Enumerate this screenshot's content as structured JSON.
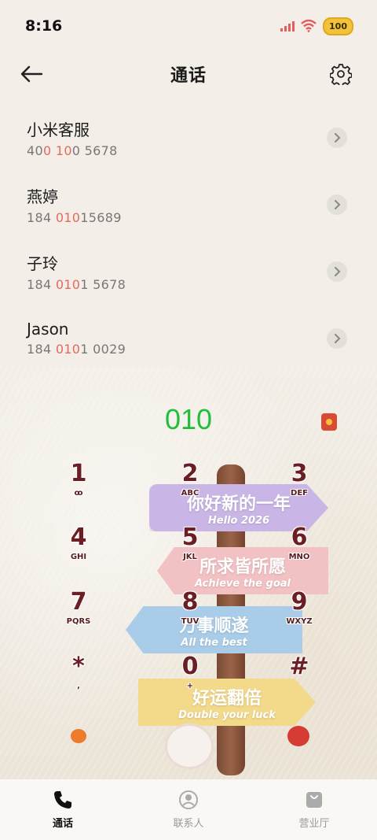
{
  "status": {
    "time": "8:16",
    "battery": "100"
  },
  "header": {
    "title": "通话"
  },
  "results": [
    {
      "name": "小米客服",
      "number_pre": "40",
      "number_hl": "0 10",
      "number_post": "0 5678"
    },
    {
      "name": "燕婷",
      "number_pre": "184 ",
      "number_hl": "010",
      "number_post": "15689"
    },
    {
      "name": "子玲",
      "number_pre": "184 ",
      "number_hl": "010",
      "number_post": "1 5678"
    },
    {
      "name": "Jason",
      "number_pre": "184 ",
      "number_hl": "010",
      "number_post": "1 0029"
    }
  ],
  "dial": {
    "input": "010"
  },
  "keypad": [
    {
      "digit": "1",
      "letters": "ꝏ"
    },
    {
      "digit": "2",
      "letters": "ABC"
    },
    {
      "digit": "3",
      "letters": "DEF"
    },
    {
      "digit": "4",
      "letters": "GHI"
    },
    {
      "digit": "5",
      "letters": "JKL"
    },
    {
      "digit": "6",
      "letters": "MNO"
    },
    {
      "digit": "7",
      "letters": "PQRS"
    },
    {
      "digit": "8",
      "letters": "TUV"
    },
    {
      "digit": "9",
      "letters": "WXYZ"
    },
    {
      "digit": "*",
      "letters": ","
    },
    {
      "digit": "0",
      "letters": "+"
    },
    {
      "digit": "#",
      "letters": ""
    }
  ],
  "signs": [
    {
      "main": "你好新的一年",
      "sub": "Hello 2026"
    },
    {
      "main": "所求皆所愿",
      "sub": "Achieve the goal"
    },
    {
      "main": "万事顺遂",
      "sub": "All the best"
    },
    {
      "main": "好运翻倍",
      "sub": "Double your luck"
    }
  ],
  "nav": [
    {
      "label": "通话",
      "icon": "phone-icon"
    },
    {
      "label": "联系人",
      "icon": "contacts-icon"
    },
    {
      "label": "营业厅",
      "icon": "store-bag-icon"
    }
  ],
  "colors": {
    "accent_green": "#1fbf3c",
    "highlight": "#e46a5d",
    "digit": "#6b1e23"
  }
}
